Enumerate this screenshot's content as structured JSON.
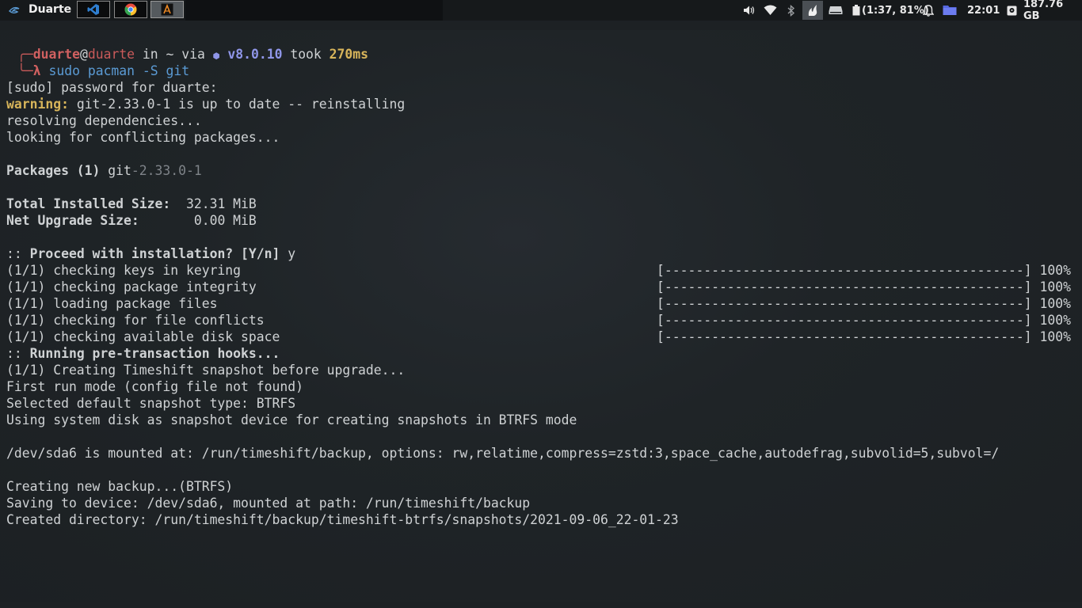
{
  "topbar": {
    "workspace_name": "Duarte",
    "tasks": [
      {
        "name": "vscode-icon",
        "color": "#2f7fd1"
      },
      {
        "name": "chrome-icon",
        "color": "#e94b3c"
      },
      {
        "name": "terminal-app-icon",
        "color": "#f08a24"
      }
    ],
    "battery": "(1:37, 81%)",
    "clock": "22:01",
    "disk": "187.76 GB",
    "accent": "#5b9bd5"
  },
  "terminal": {
    "prompt": {
      "corner_top": "╭─",
      "user": "duarte",
      "at": "@",
      "host": "duarte",
      "in": " in ",
      "dir": "~",
      "via": " via ",
      "node_icon": "⬢",
      "node_version": " v8.0.10",
      "took": " took ",
      "duration": "270ms",
      "corner_bottom": "╰─",
      "lambda": "λ",
      "command": " sudo pacman -S git"
    },
    "lines": {
      "sudo": "[sudo] password for duarte:",
      "warning_label": "warning:",
      "warning_text": " git-2.33.0-1 is up to date -- reinstalling",
      "resolving": "resolving dependencies...",
      "conflicting": "looking for conflicting packages...",
      "packages_label": "Packages (1)",
      "packages_name": " git",
      "packages_version": "-2.33.0-1",
      "total_label": "Total Installed Size:",
      "total_value": "  32.31 MiB",
      "net_label": "Net Upgrade Size:",
      "net_value": "       0.00 MiB",
      "proceed_prefix": ":: ",
      "proceed_label": "Proceed with installation? [Y/n]",
      "proceed_answer": " y",
      "hooks_prefix": ":: ",
      "hooks_label": "Running pre-transaction hooks...",
      "timeshift": "(1/1) Creating Timeshift snapshot before upgrade...",
      "first_run": "First run mode (config file not found)",
      "snapshot_type": "Selected default snapshot type: BTRFS",
      "using_disk": "Using system disk as snapshot device for creating snapshots in BTRFS mode",
      "mounted": "/dev/sda6 is mounted at: /run/timeshift/backup, options: rw,relatime,compress=zstd:3,space_cache,autodefrag,subvolid=5,subvol=/",
      "creating": "Creating new backup...(BTRFS)",
      "saving": "Saving to device: /dev/sda6, mounted at path: /run/timeshift/backup",
      "created_dir": "Created directory: /run/timeshift/backup/timeshift-btrfs/snapshots/2021-09-06_22-01-23"
    },
    "steps": [
      {
        "label": "(1/1) checking keys in keyring",
        "bar": "[----------------------------------------------]",
        "pct": "100%"
      },
      {
        "label": "(1/1) checking package integrity",
        "bar": "[----------------------------------------------]",
        "pct": "100%"
      },
      {
        "label": "(1/1) loading package files",
        "bar": "[----------------------------------------------]",
        "pct": "100%"
      },
      {
        "label": "(1/1) checking for file conflicts",
        "bar": "[----------------------------------------------]",
        "pct": "100%"
      },
      {
        "label": "(1/1) checking available disk space",
        "bar": "[----------------------------------------------]",
        "pct": "100%"
      }
    ]
  }
}
